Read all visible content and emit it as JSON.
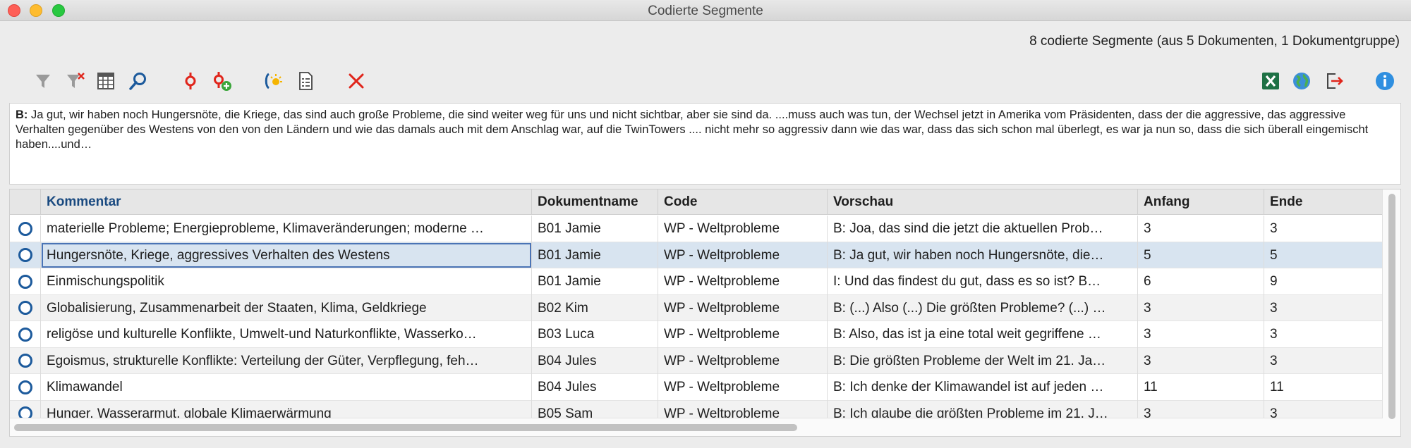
{
  "window": {
    "title": "Codierte Segmente"
  },
  "summary": "8 codierte Segmente (aus 5 Dokumenten, 1 Dokumentgruppe)",
  "toolbar": {
    "icons": [
      "filter-icon",
      "clear-filter-icon",
      "columns-icon",
      "search-icon",
      "code-icon",
      "add-code-icon",
      "smart-coding-icon",
      "overview-list-icon",
      "delete-icon",
      "excel-export-icon",
      "html-export-icon",
      "export-icon",
      "info-icon"
    ]
  },
  "preview": {
    "speaker": "B:",
    "text": " Ja gut, wir haben noch Hungersnöte, die Kriege, das sind auch große Probleme, die sind weiter weg für uns und nicht sichtbar, aber sie sind da. ....muss auch was tun, der Wechsel jetzt in Amerika vom Präsidenten, dass der die aggressive, das aggressive Verhalten gegenüber des Westens von den von den Ländern und wie das damals auch mit dem Anschlag war, auf die TwinTowers .... nicht mehr so aggressiv dann wie das war, dass das sich schon mal überlegt, es war ja nun so, dass die sich überall eingemischt haben....und…"
  },
  "table": {
    "columns": [
      "Kommentar",
      "Dokumentname",
      "Code",
      "Vorschau",
      "Anfang",
      "Ende"
    ],
    "rows": [
      {
        "kommentar": "materielle Probleme; Energieprobleme, Klimaveränderungen; moderne …",
        "dokument": "B01 Jamie",
        "code": "WP - Weltprobleme",
        "vorschau": "B: Joa, das sind die jetzt die aktuellen Prob…",
        "anfang": "3",
        "ende": "3"
      },
      {
        "kommentar": "Hungersnöte, Kriege, aggressives Verhalten des Westens",
        "dokument": "B01 Jamie",
        "code": "WP - Weltprobleme",
        "vorschau": "B: Ja gut, wir haben noch Hungersnöte, die…",
        "anfang": "5",
        "ende": "5"
      },
      {
        "kommentar": "Einmischungspolitik",
        "dokument": "B01 Jamie",
        "code": "WP - Weltprobleme",
        "vorschau": "I: Und das findest du gut, dass es so ist?  B…",
        "anfang": "6",
        "ende": "9"
      },
      {
        "kommentar": "Globalisierung, Zusammenarbeit der Staaten, Klima, Geldkriege",
        "dokument": "B02 Kim",
        "code": "WP - Weltprobleme",
        "vorschau": "B: (...) Also (...) Die größten Probleme? (...) …",
        "anfang": "3",
        "ende": "3"
      },
      {
        "kommentar": "religöse und kulturelle Konflikte, Umwelt-und Naturkonflikte, Wasserko…",
        "dokument": "B03 Luca",
        "code": "WP - Weltprobleme",
        "vorschau": "B: Also, das ist ja eine total weit gegriffene …",
        "anfang": "3",
        "ende": "3"
      },
      {
        "kommentar": "Egoismus, strukturelle Konflikte: Verteilung der Güter, Verpflegung, feh…",
        "dokument": "B04 Jules",
        "code": "WP - Weltprobleme",
        "vorschau": "B: Die größten Probleme der Welt im 21. Ja…",
        "anfang": "3",
        "ende": "3"
      },
      {
        "kommentar": "Klimawandel",
        "dokument": "B04 Jules",
        "code": "WP - Weltprobleme",
        "vorschau": "B: Ich denke der Klimawandel ist auf jeden …",
        "anfang": "11",
        "ende": "11"
      },
      {
        "kommentar": "Hunger, Wasserarmut, globale Klimaerwärmung",
        "dokument": "B05 Sam",
        "code": "WP - Weltprobleme",
        "vorschau": "B: Ich glaube die größten Probleme im 21. J…",
        "anfang": "3",
        "ende": "3"
      }
    ]
  },
  "colors": {
    "accent": "#1c5a9c",
    "selection": "#d8e4f0",
    "delete": "#e0251b",
    "code": "#e0251b",
    "excel": "#1e7145"
  }
}
